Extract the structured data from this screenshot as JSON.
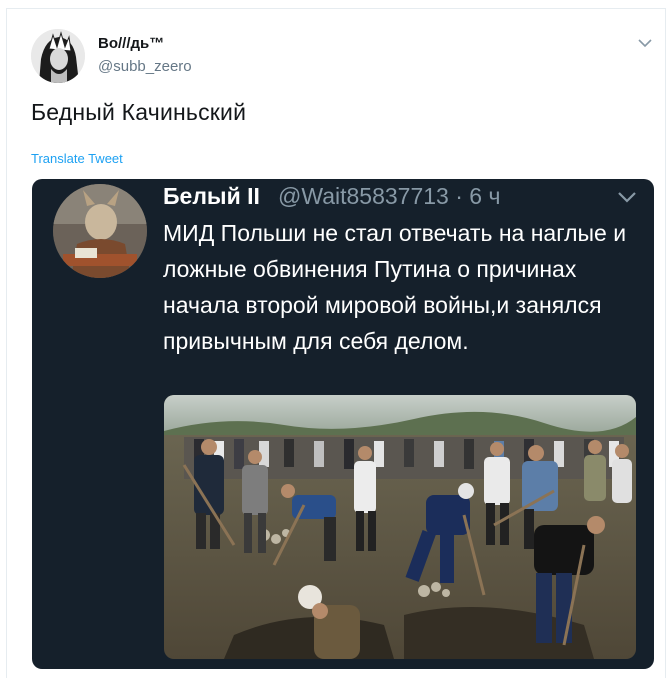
{
  "author": {
    "display_name": "Во///дь™",
    "handle": "@subb_zeero"
  },
  "tweet": {
    "text": "Бедный Качиньский",
    "translate_label": "Translate Tweet"
  },
  "quoted_screenshot": {
    "name": "Белый II",
    "handle_time": "@Wait85837713 · 6 ч",
    "text": "МИД Польши не стал отвечать на наглые и ложные обвинения Путина о причинах начала второй мировой войны,и занялся привычным для себя делом."
  },
  "icons": {
    "top_menu": "chevron-down-icon",
    "inner_menu": "chevron-down-icon"
  },
  "colors": {
    "accent": "#1da1f2",
    "text_primary": "#14171a",
    "text_secondary": "#657786",
    "dark_bg": "#15202b",
    "dark_secondary": "#8899a6"
  }
}
